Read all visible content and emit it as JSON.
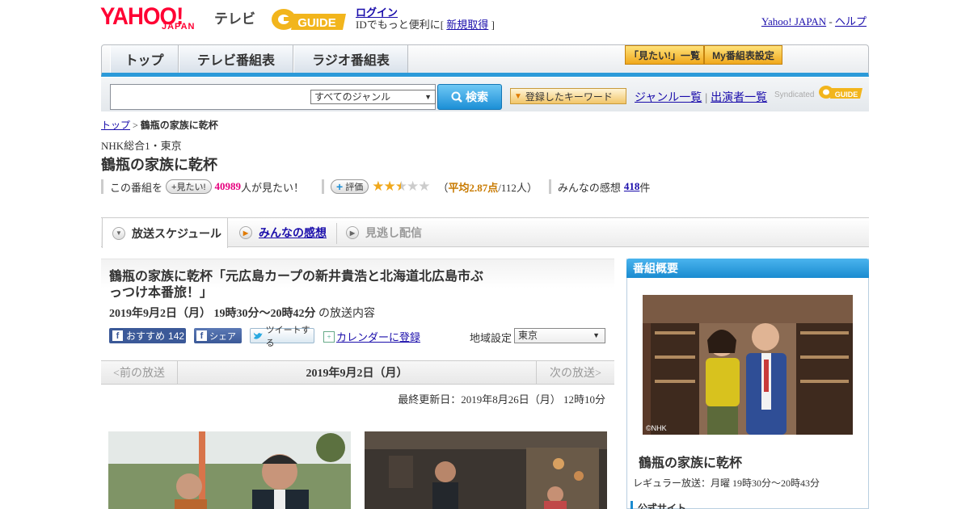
{
  "header": {
    "logo_main": "YAHOO!",
    "logo_sub": "JAPAN",
    "logo_tv": "テレビ",
    "gguide_logo": "G-GUIDE",
    "login_link": "ログイン",
    "login_text": "IDでもっと便利に[",
    "signup_link": "新規取得",
    "signup_close": "]",
    "yahoo_link": "Yahoo! JAPAN",
    "link_sep": " - ",
    "help_link": "ヘルプ"
  },
  "nav": {
    "tabs": [
      {
        "label": "トップ"
      },
      {
        "label": "テレビ番組表"
      },
      {
        "label": "ラジオ番組表"
      }
    ],
    "mitai_list": "「見たい!」一覧",
    "my_settings": "My番組表設定"
  },
  "search": {
    "genre_selected": "すべてのジャンル",
    "search_button": "検索",
    "keyword_button": "登録したキーワード",
    "genre_list_link": "ジャンル一覧",
    "link_sep": "|",
    "performers_link": "出演者一覧",
    "syndicated": "Syndicated"
  },
  "breadcrumb": {
    "top": "トップ",
    "sep": " > ",
    "current": "鶴瓶の家族に乾杯"
  },
  "program": {
    "channel": "NHK総合1・東京",
    "title": "鶴瓶の家族に乾杯",
    "mitai_prefix": "この番組を",
    "mitai_pill": "見たい!",
    "mitai_count": "40989",
    "mitai_suffix": "人が見たい！",
    "eval_pill": "評価",
    "rating_value": 2.87,
    "rating_open": "（",
    "rating_avg": "平均2.87点",
    "rating_count": "/112人）",
    "impressions_prefix": "みんなの感想",
    "impressions_count": "418",
    "impressions_suffix": "件"
  },
  "tabs": {
    "schedule": "放送スケジュール",
    "impressions": "みんなの感想",
    "missed": "見逃し配信"
  },
  "episode": {
    "title": "鶴瓶の家族に乾杯「元広島カープの新井貴浩と北海道北広島市ぶっつけ本番旅！」",
    "date_time": "2019年9月2日（月） 19時30分～20時42分",
    "date_suffix": "の放送内容",
    "fb_recommend": "おすすめ",
    "fb_count": "142",
    "fb_share": "シェア",
    "tweet": "ツイートする",
    "calendar": "カレンダーに登録",
    "region_label": "地域設定",
    "region_value": "東京"
  },
  "pager": {
    "prev": "<前の放送",
    "current": "2019年9月2日（月）",
    "next": "次の放送>"
  },
  "updated": "最終更新日：2019年8月26日（月） 12時10分",
  "sidebar": {
    "heading": "番組概要",
    "photo_credit": "©NHK",
    "title": "鶴瓶の家族に乾杯",
    "regular": "レギュラー放送：月曜 19時30分～20時43分",
    "official": "公式サイト"
  },
  "colors": {
    "accent_blue": "#1a8bd0",
    "brand_red": "#ff0033",
    "pink": "#e6007e",
    "star_gold": "#f0a81c"
  }
}
